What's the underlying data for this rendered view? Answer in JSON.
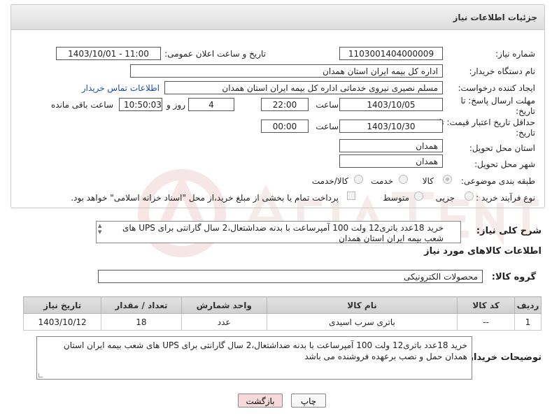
{
  "header": {
    "title": "جزئیات اطلاعات نیاز"
  },
  "form": {
    "need_number_label": "شماره نیاز:",
    "need_number": "1103001404000009",
    "announce_label": "تاریخ و ساعت اعلان عمومی:",
    "announce_value": "1403/10/01 - 11:00",
    "buyer_org_label": "نام دستگاه خریدار:",
    "buyer_org": "اداره کل بیمه ایران استان همدان",
    "creator_label": "ایجاد کننده درخواست:",
    "creator": "مسلم نصیری نیروی خدماتی اداره کل بیمه ایران استان همدان",
    "contact_link": "اطلاعات تماس خریدار",
    "reply_deadline_label_1": "مهلت ارسال پاسخ: تا",
    "reply_deadline_label_2": "تاریخ:",
    "reply_date": "1403/10/05",
    "time_label": "ساعت",
    "reply_time": "22:00",
    "days_value": "4",
    "days_label": "روز و",
    "remaining_time": "10:50:03",
    "remaining_label": "ساعت باقی مانده",
    "validity_label_1": "حداقل تاریخ اعتبار قیمت: تا",
    "validity_label_2": "تاریخ:",
    "validity_date": "1403/10/30",
    "validity_time": "00:00",
    "province_label": "استان محل تحویل:",
    "province": "همدان",
    "city_label": "شهر محل تحویل:",
    "city": "همدان",
    "category_label": "طبقه بندی موضوعی:",
    "category_options": [
      "کالا",
      "خدمت",
      "کالا/خدمت"
    ],
    "purchase_type_label": "نوع فرآیند خرید :",
    "purchase_options": [
      "جزیی",
      "متوسط"
    ],
    "payment_note": "پرداخت تمام یا بخشی از مبلغ خرید،از محل \"اسناد خزانه اسلامی\" خواهد بود."
  },
  "summary": {
    "label": "شرح کلی نیاز:",
    "text": "خرید 18عدد باتری12 ولت 100 آمپرساعت با بدنه ضداشتعال،2 سال گارانتی برای UPS های شعب بیمه ایران استان همدان"
  },
  "goods": {
    "section_title": "اطلاعات کالاهای مورد نیاز",
    "group_label": "گروه کالا:",
    "group_value": "محصولات الکترونیکی",
    "columns": [
      "ردیف",
      "کد کالا",
      "نام کالا",
      "واحد شمارش",
      "تعداد / مقدار",
      "تاریخ نیاز"
    ],
    "rows": [
      [
        "1",
        "--",
        "باتری سرب اسیدی",
        "عدد",
        "18",
        "1403/10/12"
      ]
    ]
  },
  "buyer_notes": {
    "label": "توضیحات خریدار:",
    "text": "خرید 18عدد باتری12 ولت 100 آمپرساعت با بدنه ضداشتعال،2 سال گارانتی برای UPS های شعب بیمه ایران استان همدان حمل و نصب برعهده فروشنده می باشد"
  },
  "buttons": {
    "print": "چاپ",
    "back": "بازگشت"
  },
  "colors": {
    "link": "#1a4fa0",
    "back_button": "#f7d9d9",
    "watermark": "#f1d3d3"
  }
}
